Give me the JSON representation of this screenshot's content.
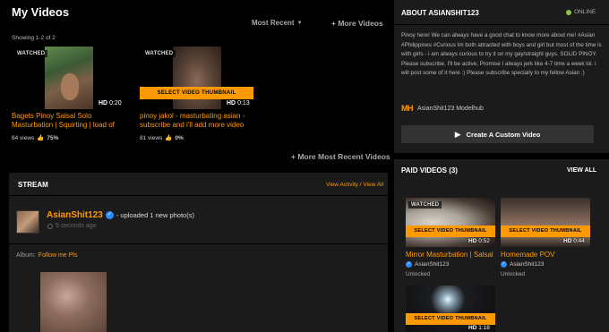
{
  "my_videos": {
    "title": "My Videos",
    "sort_label": "Most Recent",
    "more_videos_label": "+ More Videos",
    "showing": "Showing 1-2 of 2",
    "more_recent_label": "+ More Most Recent Videos",
    "videos": [
      {
        "badge": "WATCHED",
        "duration_hd": "HD",
        "duration": "0:20",
        "title_line1": "Bagets Pinoy Salsal Solo",
        "title_line2": "Masturbation | Squirting | load of",
        "views": "84 views",
        "rating": "75%"
      },
      {
        "badge": "WATCHED",
        "duration_hd": "HD",
        "duration": "0:13",
        "select_label": "SELECT VIDEO THUMBNAIL",
        "title_line1": "pinoy jakol - masturbating asian -",
        "title_line2": "subscribe and i'll add more video",
        "views": "81 views",
        "rating": "0%"
      }
    ]
  },
  "stream": {
    "title": "STREAM",
    "links": "View Activity / View All",
    "user": "AsianShit123",
    "action": "- uploaded 1 new photo(s)",
    "time": "5 seconds ago",
    "album_label": "Album:",
    "album_name": "Follow me Pls"
  },
  "about": {
    "title": "ABOUT ASIANSHIT123",
    "status": "ONLINE",
    "bio": "Pinoy here! We can always have a good chat to know more about me! #Asian #Philippines #Curious Im both attracted with boys and girl but most of the time is with girls - i am always curious to try it on my gay/straight guys. SOLID PINOY. Please subscribe. I'll be active, Promise I always jerk like 4-7 time a week lol. i will post some of it here :) Please subscribe specially to my fellow Asian :)",
    "mh_logo": "MH",
    "modelhub": "AsianShit123 Modelhub",
    "create_video": "Create A Custom Video"
  },
  "paid": {
    "title": "PAID VIDEOS (3)",
    "view_all": "VIEW ALL",
    "videos": [
      {
        "badge": "WATCHED",
        "select_label": "SELECT VIDEO THUMBNAIL",
        "hd": "HD",
        "duration": "0:52",
        "title": "Mirror Masturbation | Salsal",
        "user": "AsianShit123",
        "status": "Unlocked"
      },
      {
        "select_label": "SELECT VIDEO THUMBNAIL",
        "hd": "HD",
        "duration": "0:44",
        "title": "Homemade POV",
        "user": "AsianShit123",
        "status": "Unlocked"
      },
      {
        "select_label": "SELECT VIDEO THUMBNAIL",
        "hd": "HD",
        "duration": "1:18"
      }
    ]
  },
  "colors": {
    "accent": "#ff9900",
    "online": "#8bc34a",
    "verified": "#2a8cff"
  },
  "icons": [
    "chevron-down-icon",
    "thumbs-up-icon",
    "verified-icon",
    "clock-icon",
    "play-icon"
  ]
}
